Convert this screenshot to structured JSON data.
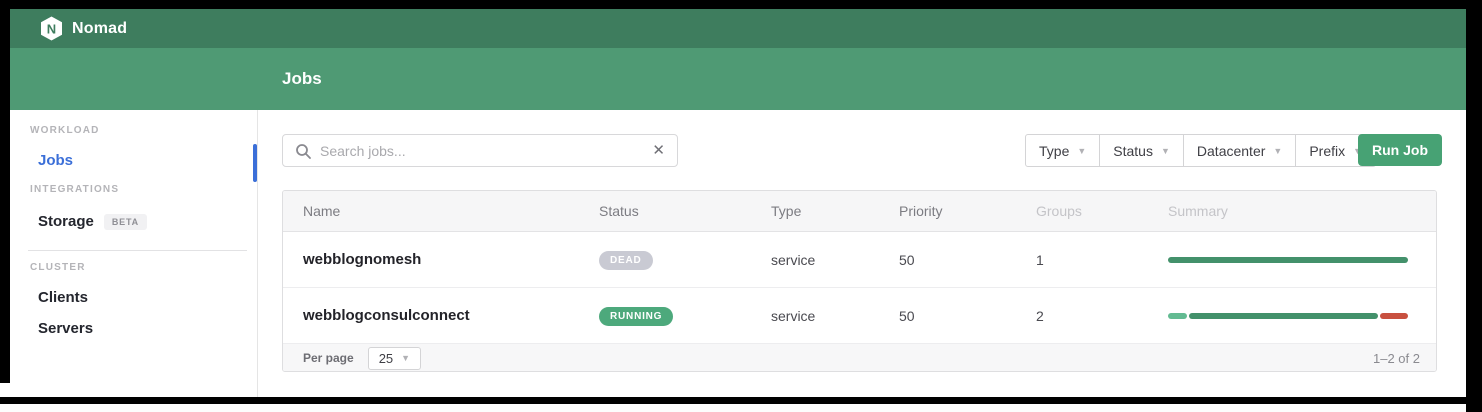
{
  "topbar": {
    "brand": "Nomad"
  },
  "subheader": {
    "title": "Jobs"
  },
  "sidebar": {
    "workload_label": "WORKLOAD",
    "integrations_label": "INTEGRATIONS",
    "cluster_label": "CLUSTER",
    "jobs_label": "Jobs",
    "storage_label": "Storage",
    "storage_badge": "BETA",
    "clients_label": "Clients",
    "servers_label": "Servers"
  },
  "toolbar": {
    "search_placeholder": "Search jobs...",
    "clear_glyph": "✕",
    "filters": [
      "Type",
      "Status",
      "Datacenter",
      "Prefix"
    ],
    "caret_glyph": "▼",
    "run_job_label": "Run Job"
  },
  "table": {
    "columns": [
      "Name",
      "Status",
      "Type",
      "Priority",
      "Groups",
      "Summary"
    ],
    "rows": [
      {
        "name": "webblognomesh",
        "status": "DEAD",
        "status_bg": "#c9cad3",
        "type": "service",
        "priority": "50",
        "groups": "1",
        "summary": [
          {
            "color": "#43916b",
            "pct": 100
          }
        ]
      },
      {
        "name": "webblogconsulconnect",
        "status": "RUNNING",
        "status_bg": "#4da97c",
        "type": "service",
        "priority": "50",
        "groups": "2",
        "summary": [
          {
            "color": "#63bb92",
            "pct": 8
          },
          {
            "color": "#43916b",
            "pct": 80
          },
          {
            "color": "#c8503f",
            "pct": 12
          }
        ]
      }
    ],
    "footer": {
      "per_page_label": "Per page",
      "per_page_value": "25",
      "range": "1–2 of 2"
    }
  },
  "colors": {
    "topbar": "#3e7d5e",
    "subheader": "#4f9a74",
    "accent_green": "#47a274",
    "active_blue": "#3b6fd8",
    "summary_green": "#43916b",
    "summary_light_green": "#63bb92",
    "summary_red": "#c8503f"
  }
}
